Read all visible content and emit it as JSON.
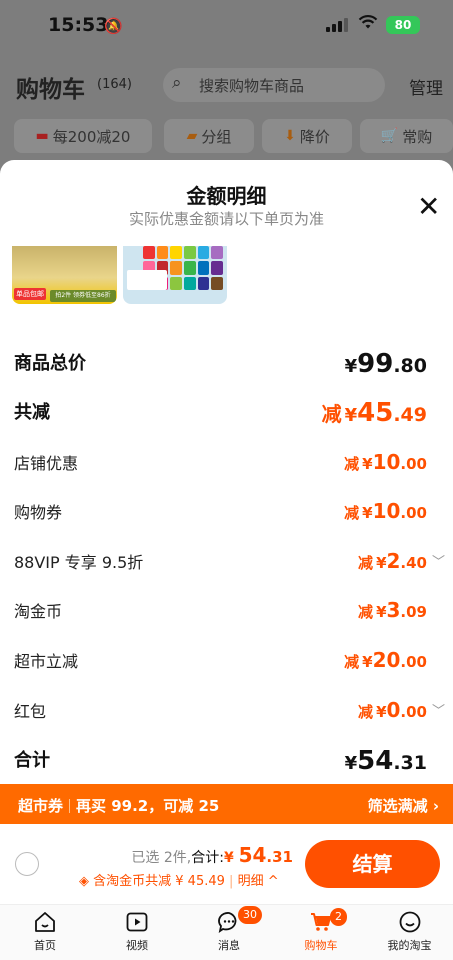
{
  "status_bar": {
    "time": "15:53",
    "battery": "80"
  },
  "background_header": {
    "title": "购物车",
    "count": "(164)",
    "search_placeholder": "搜索购物车商品",
    "manage": "管理",
    "chips": [
      "每200减20",
      "分组",
      "降价",
      "常购"
    ]
  },
  "sheet": {
    "title": "金额明细",
    "subtitle": "实际优惠金额请以下单页为准",
    "thumb1_tag": "单品包邮",
    "thumb1_band": "拍2件 领券低至86折",
    "rows": [
      {
        "label": "商品总价",
        "prefix": "",
        "yen": "¥",
        "int": "99",
        "dec": ".80"
      },
      {
        "label": "共减",
        "prefix": "减",
        "yen": "¥",
        "int": "45",
        "dec": ".49"
      },
      {
        "label": "店铺优惠",
        "prefix": "减",
        "yen": "¥",
        "int": "10",
        "dec": ".00"
      },
      {
        "label": "购物券",
        "prefix": "减",
        "yen": "¥",
        "int": "10",
        "dec": ".00"
      },
      {
        "label": "88VIP 专享 9.5折",
        "prefix": "减",
        "yen": "¥",
        "int": "2",
        "dec": ".40"
      },
      {
        "label": "淘金币",
        "prefix": "减",
        "yen": "¥",
        "int": "3",
        "dec": ".09"
      },
      {
        "label": "超市立减",
        "prefix": "减",
        "yen": "¥",
        "int": "20",
        "dec": ".00"
      },
      {
        "label": "红包",
        "prefix": "减",
        "yen": "¥",
        "int": "0",
        "dec": ".00"
      },
      {
        "label": "合计",
        "prefix": "",
        "yen": "¥",
        "int": "54",
        "dec": ".31"
      }
    ]
  },
  "banner": {
    "left_a": "超市券",
    "left_b": "再买 99.2，可减 25",
    "right": "筛选满减 ›"
  },
  "checkout": {
    "selected": "已选 2件,",
    "total_label": "合计:",
    "yen": "¥ ",
    "int": "54",
    "dec": ".31",
    "savings": "含淘金币共减 ¥ 45.49",
    "detail": "明细 ^",
    "pay": "结算"
  },
  "tabbar": {
    "items": [
      {
        "label": "首页",
        "icon": "home-icon"
      },
      {
        "label": "视频",
        "icon": "video-icon"
      },
      {
        "label": "消息",
        "icon": "message-icon",
        "badge": "30"
      },
      {
        "label": "购物车",
        "icon": "cart-icon",
        "badge": "2"
      },
      {
        "label": "我的淘宝",
        "icon": "profile-icon"
      }
    ]
  },
  "colors": {
    "accent": "#ff5000",
    "banner": "#ff6a00"
  }
}
